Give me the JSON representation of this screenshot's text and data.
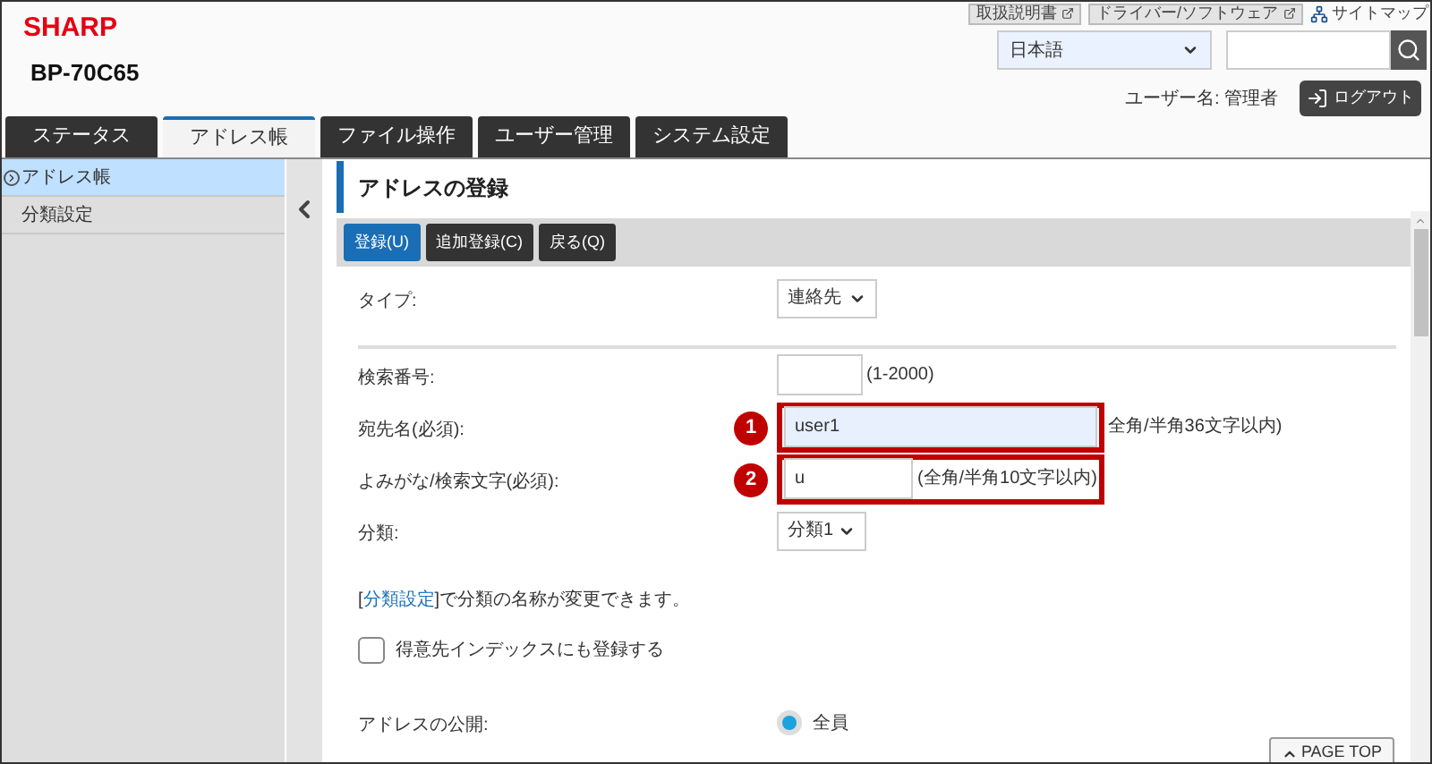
{
  "header": {
    "logo": "SHARP",
    "model": "BP-70C65",
    "links": [
      {
        "label": "取扱説明書",
        "kind": "external"
      },
      {
        "label": "ドライバー/ソフトウェア",
        "kind": "external"
      },
      {
        "label": "サイトマップ",
        "kind": "sitemap"
      }
    ],
    "language": "日本語",
    "user": "ユーザー名: 管理者",
    "logout": "ログアウト"
  },
  "tabs": [
    {
      "label": "ステータス",
      "selected": false
    },
    {
      "label": "アドレス帳",
      "selected": true
    },
    {
      "label": "ファイル操作",
      "selected": false
    },
    {
      "label": "ユーザー管理",
      "selected": false
    },
    {
      "label": "システム設定",
      "selected": false
    }
  ],
  "sidebar": {
    "items": [
      {
        "label": "アドレス帳",
        "selected": true
      },
      {
        "label": "分類設定",
        "selected": false
      }
    ]
  },
  "page_title": "アドレスの登録",
  "toolbar": [
    {
      "label": "登録(U)",
      "kind": "primary"
    },
    {
      "label": "追加登録(C)",
      "kind": "default"
    },
    {
      "label": "戻る(Q)",
      "kind": "default"
    }
  ],
  "form": [
    {
      "kind": "select",
      "label": "タイプ:",
      "value": "連絡先"
    },
    {
      "kind": "divider"
    },
    {
      "kind": "text",
      "label": "検索番号:",
      "hint": "(1-2000)",
      "focused": false
    },
    {
      "kind": "text",
      "label": "宛先名(必須):",
      "value": "user1",
      "hint": "全角/半角36文字以内)",
      "focused": true,
      "marker": "1"
    },
    {
      "kind": "text",
      "label": "よみがな/検索文字(必須):",
      "value": "u",
      "hint": "(全角/半角10文字以内)",
      "focused": false,
      "marker": "2"
    },
    {
      "kind": "select",
      "label": "分類:",
      "value": "分類1"
    },
    {
      "kind": "note",
      "before": "[",
      "link": "分類設定",
      "after": "]で分類の名称が変更できます。"
    },
    {
      "kind": "checkbox",
      "label": "得意先インデックスにも登録する",
      "checked": false
    },
    {
      "kind": "radio",
      "label": "アドレスの公開:",
      "options": [
        {
          "label": "全員",
          "selected": true
        }
      ]
    }
  ],
  "page_top": "PAGE TOP"
}
